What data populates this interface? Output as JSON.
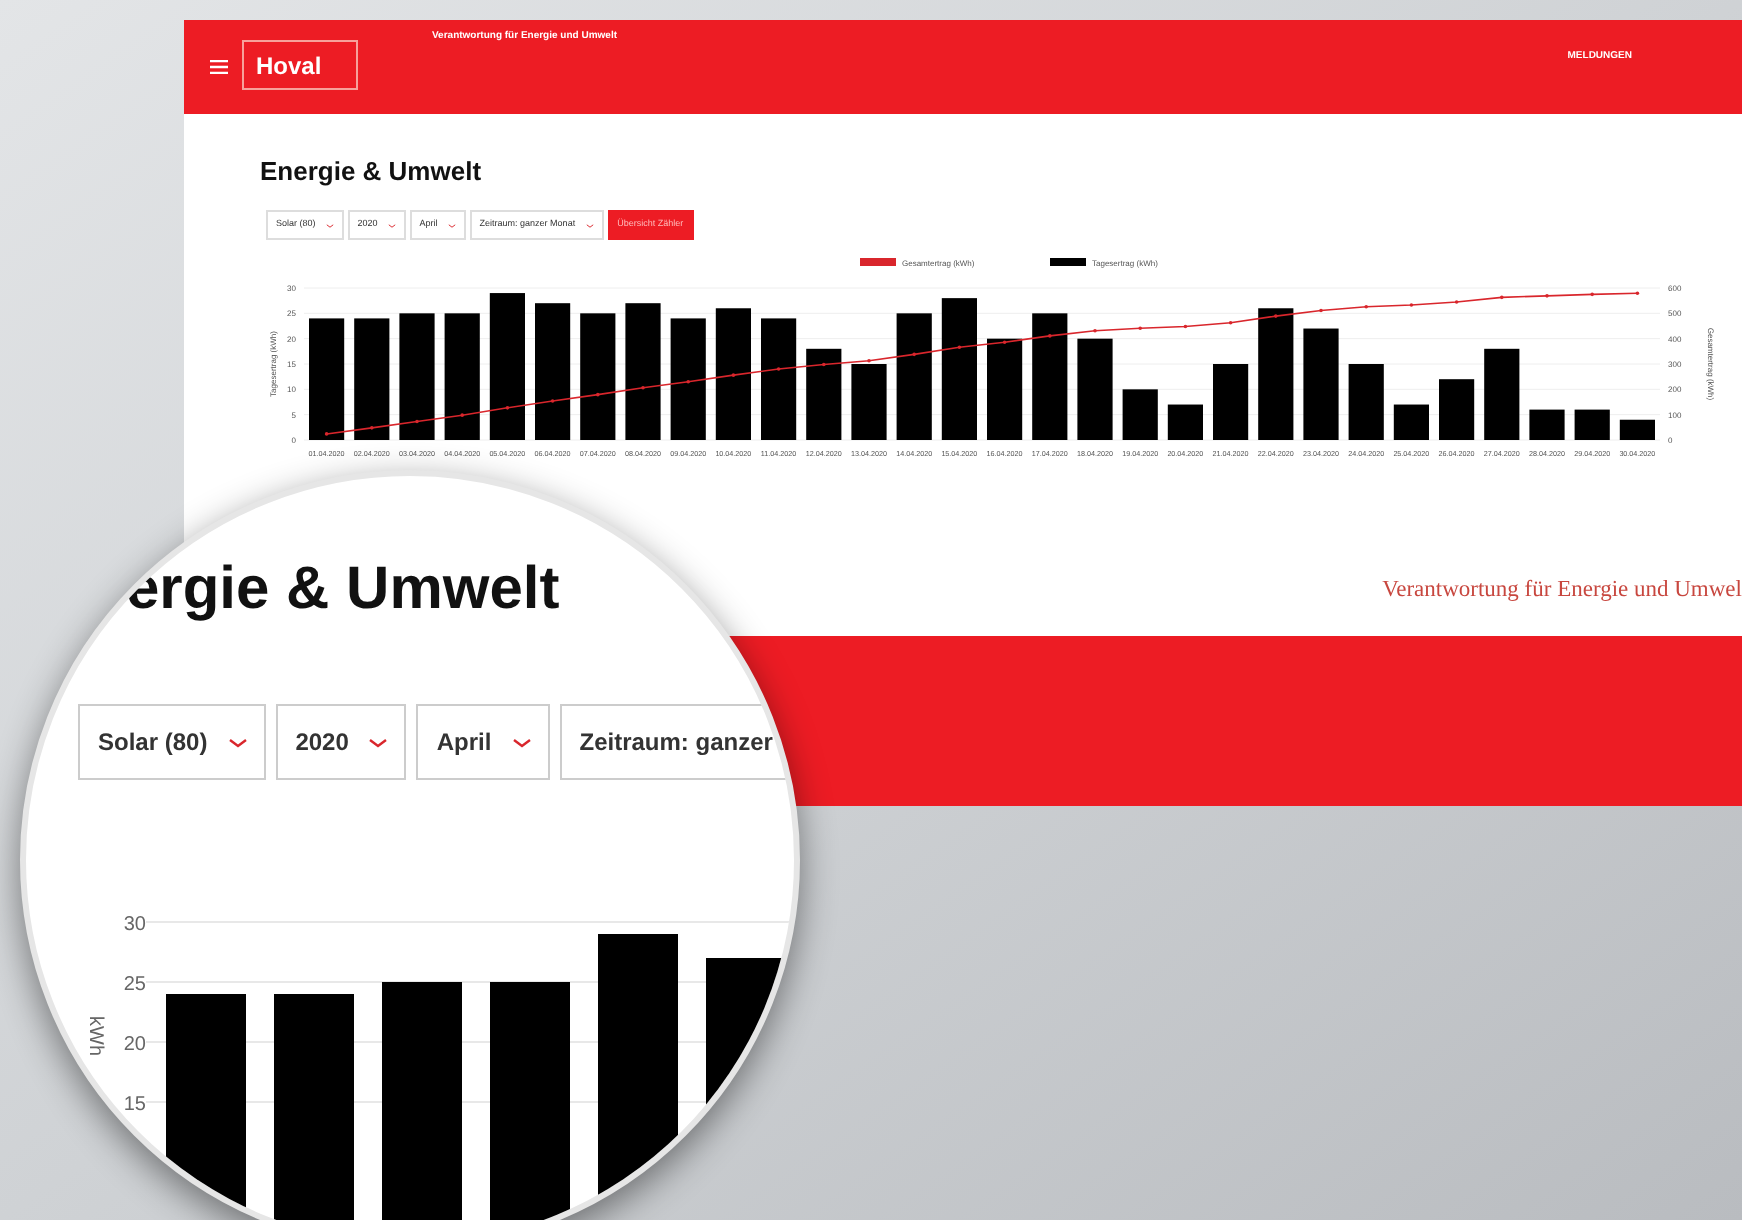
{
  "header": {
    "logo": "Hoval",
    "tagline": "Verantwortung für Energie und Umwelt",
    "nav_link": "MELDUNGEN"
  },
  "page": {
    "title": "Energie & Umwelt",
    "filters": [
      "Solar (80)",
      "2020",
      "April",
      "Zeitraum: ganzer Monat"
    ],
    "button": "Übersicht Zähler"
  },
  "chart": {
    "chart_data": {
      "type": "bar",
      "ylabel": "Tagesertrag (kWh)",
      "grid": true,
      "categories": [
        "01.04.2020",
        "02.04.2020",
        "03.04.2020",
        "04.04.2020",
        "05.04.2020",
        "06.04.2020",
        "07.04.2020",
        "08.04.2020",
        "09.04.2020",
        "10.04.2020",
        "11.04.2020",
        "12.04.2020",
        "13.04.2020",
        "14.04.2020",
        "15.04.2020",
        "16.04.2020",
        "17.04.2020",
        "18.04.2020",
        "19.04.2020",
        "20.04.2020",
        "21.04.2020",
        "22.04.2020",
        "23.04.2020",
        "24.04.2020",
        "25.04.2020",
        "26.04.2020",
        "27.04.2020",
        "28.04.2020",
        "29.04.2020",
        "30.04.2020"
      ],
      "series": [
        {
          "name": "Tagesertrag (kWh)",
          "color": "#000000",
          "values": [
            24,
            24,
            25,
            25,
            29,
            27,
            25,
            27,
            24,
            26,
            24,
            18,
            15,
            25,
            28,
            20,
            25,
            20,
            10,
            7,
            15,
            26,
            22,
            15,
            7,
            12,
            18,
            6,
            6,
            4
          ]
        }
      ],
      "ylim": [
        0,
        30
      ],
      "yticks": [
        0,
        5,
        10,
        15,
        20,
        25,
        30
      ]
    }
  },
  "cumulative_chart": {
    "chart_data": {
      "type": "line",
      "ylabel": "Gesamtertrag (kWh)",
      "series": [
        {
          "name": "Gesamtertrag (kWh)",
          "color": "#d9262c",
          "values": [
            24,
            48,
            73,
            98,
            127,
            154,
            179,
            206,
            230,
            256,
            280,
            298,
            313,
            338,
            366,
            386,
            411,
            431,
            441,
            448,
            463,
            489,
            511,
            526,
            533,
            545,
            563,
            569,
            575,
            579
          ]
        }
      ],
      "ylim": [
        0,
        600
      ],
      "yticks": [
        0,
        100,
        200,
        300,
        400,
        500,
        600
      ]
    }
  },
  "footer": {
    "slogan": "Verantwortung für Energie und Umwel"
  },
  "magnifier": {
    "title": "ergie & Umwelt",
    "filters": [
      "Solar (80)",
      "2020",
      "April",
      "Zeitraum: ganzer"
    ],
    "y_axis_label": "kWh",
    "yticks": [
      "30",
      "25",
      "20",
      "15"
    ]
  }
}
